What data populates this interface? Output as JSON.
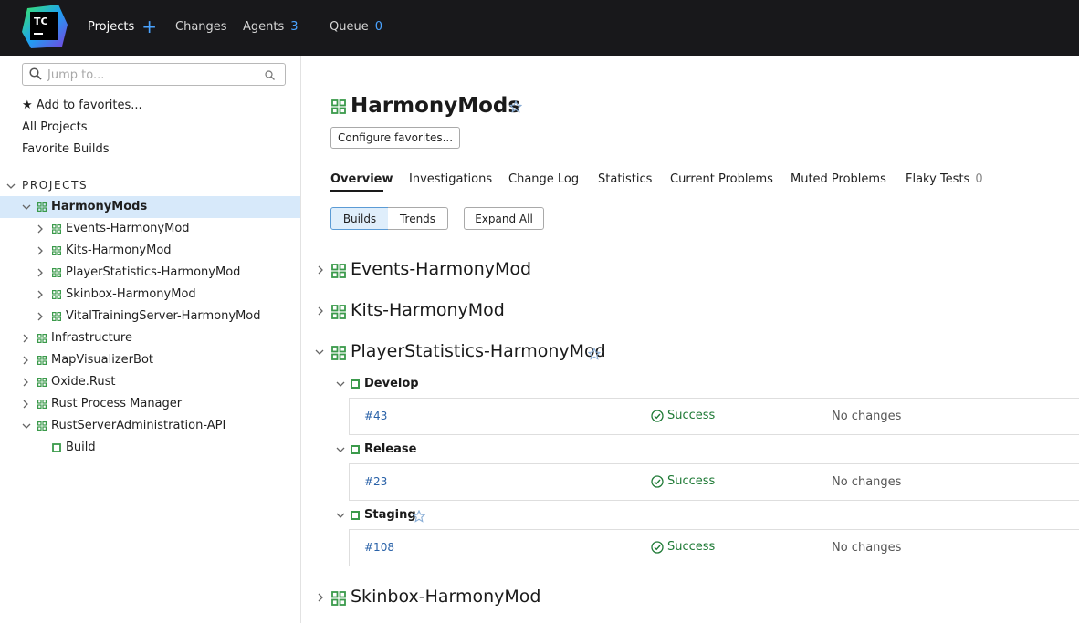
{
  "topbar": {
    "logo_text": "TC",
    "projects_label": "Projects",
    "changes_label": "Changes",
    "agents_label": "Agents",
    "agents_count": "3",
    "queue_label": "Queue",
    "queue_count": "0"
  },
  "sidebar": {
    "search_placeholder": "Jump to...",
    "add_favorites": "★ Add to favorites...",
    "all_projects": "All Projects",
    "favorite_builds": "Favorite Builds",
    "projects_header": "PROJECTS",
    "tree": [
      {
        "label": "HarmonyMods"
      },
      {
        "label": "Events-HarmonyMod"
      },
      {
        "label": "Kits-HarmonyMod"
      },
      {
        "label": "PlayerStatistics-HarmonyMod"
      },
      {
        "label": "Skinbox-HarmonyMod"
      },
      {
        "label": "VitalTrainingServer-HarmonyMod"
      },
      {
        "label": "Infrastructure"
      },
      {
        "label": "MapVisualizerBot"
      },
      {
        "label": "Oxide.Rust"
      },
      {
        "label": "Rust Process Manager"
      },
      {
        "label": "RustServerAdministration-API"
      },
      {
        "label": "Build"
      }
    ]
  },
  "main": {
    "title": "HarmonyMods",
    "configure_favorites": "Configure favorites...",
    "tabs": [
      {
        "label": "Overview"
      },
      {
        "label": "Investigations"
      },
      {
        "label": "Change Log"
      },
      {
        "label": "Statistics"
      },
      {
        "label": "Current Problems"
      },
      {
        "label": "Muted Problems"
      },
      {
        "label": "Flaky Tests",
        "count": "0"
      }
    ],
    "view_builds": "Builds",
    "view_trends": "Trends",
    "expand_all": "Expand All",
    "projects": [
      {
        "name": "Events-HarmonyMod"
      },
      {
        "name": "Kits-HarmonyMod"
      },
      {
        "name": "PlayerStatistics-HarmonyMod"
      },
      {
        "name": "Skinbox-HarmonyMod"
      }
    ],
    "build_types": [
      {
        "name": "Develop",
        "build_number": "#43",
        "status": "Success",
        "changes": "No changes"
      },
      {
        "name": "Release",
        "build_number": "#23",
        "status": "Success",
        "changes": "No changes"
      },
      {
        "name": "Staging",
        "build_number": "#108",
        "status": "Success",
        "changes": "No changes"
      }
    ]
  },
  "colors": {
    "topbar_bg": "#18181b",
    "accent_blue": "#4aa3ff",
    "success_green": "#1f7a36",
    "project_icon_green": "#3b9a4b",
    "selected_row": "#d7e9fa"
  }
}
